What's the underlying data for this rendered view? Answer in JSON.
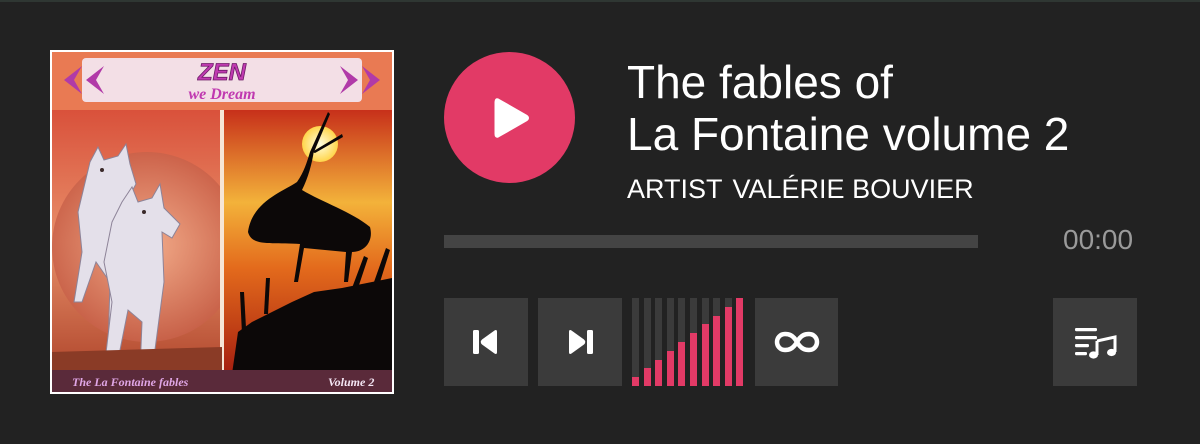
{
  "track": {
    "title_line1": "The fables of",
    "title_line2": "La Fontaine volume 2",
    "artist_label": "ARTIST",
    "artist_name": "VALÉRIE BOUVIER"
  },
  "cover": {
    "heading": "ZEN",
    "subheading": "we Dream",
    "caption": "The La Fontaine fables",
    "volume_label": "Volume 2"
  },
  "player": {
    "time": "00:00",
    "progress": 0,
    "volume_levels": 10,
    "volume_active": 10
  },
  "icons": {
    "play": "play-icon",
    "previous": "skip-previous-icon",
    "next": "skip-next-icon",
    "loop": "infinity-loop-icon",
    "playlist": "playlist-music-icon"
  },
  "colors": {
    "accent": "#e23a66",
    "background": "#222222",
    "control": "#3b3b3b",
    "text": "#ffffff",
    "muted": "#9a9a9a"
  }
}
